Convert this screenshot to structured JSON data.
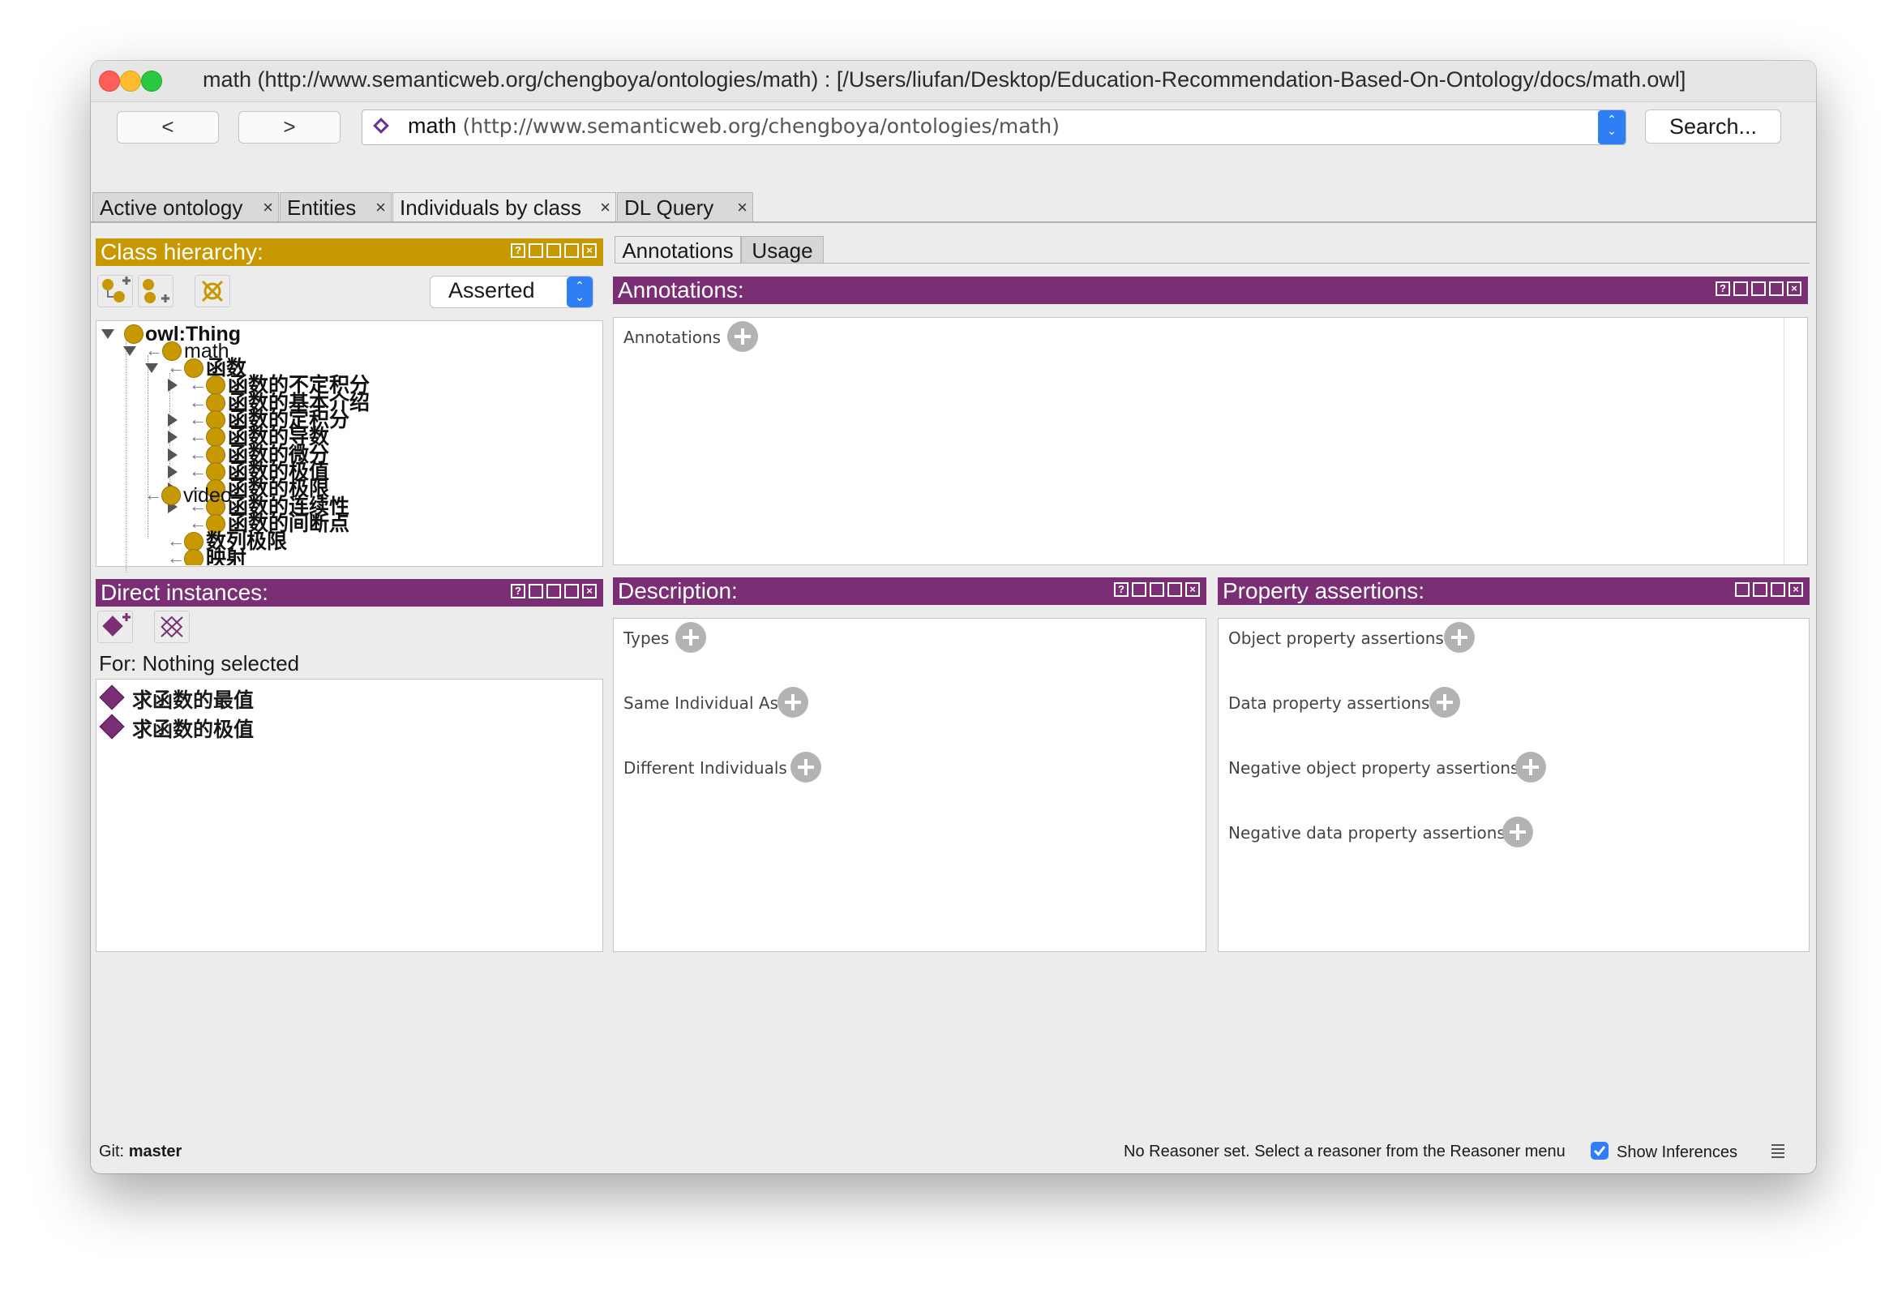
{
  "window": {
    "title": "math (http://www.semanticweb.org/chengboya/ontologies/math)  : [/Users/liufan/Desktop/Education-Recommendation-Based-On-Ontology/docs/math.owl]"
  },
  "toolbar": {
    "back_label": "<",
    "forward_label": ">",
    "ontology_name": "math",
    "ontology_iri": "(http://www.semanticweb.org/chengboya/ontologies/math)",
    "search_label": "Search..."
  },
  "tabs": [
    {
      "label": "Active ontology",
      "active": false
    },
    {
      "label": "Entities",
      "active": false
    },
    {
      "label": "Individuals by class",
      "active": true
    },
    {
      "label": "DL Query",
      "active": false
    }
  ],
  "tab_close": "×",
  "class_hierarchy": {
    "title": "Class hierarchy:",
    "mode": "Asserted",
    "tree": [
      {
        "label": "owl:Thing"
      },
      {
        "label": "math"
      },
      {
        "label": "函数"
      },
      {
        "label": "函数的不定积分"
      },
      {
        "label": "函数的基本介绍"
      },
      {
        "label": "函数的定积分"
      },
      {
        "label": "函数的导数"
      },
      {
        "label": "函数的微分"
      },
      {
        "label": "函数的极值"
      },
      {
        "label": "函数的极限"
      },
      {
        "label": "函数的连续性"
      },
      {
        "label": "函数的间断点"
      },
      {
        "label": "数列极限"
      },
      {
        "label": "映射"
      },
      {
        "label": "video"
      }
    ]
  },
  "direct_instances": {
    "title": "Direct instances:",
    "for_label": "For: Nothing selected",
    "items": [
      "求函数的最值",
      "求函数的极值"
    ]
  },
  "right_tabs": [
    {
      "label": "Annotations",
      "active": true
    },
    {
      "label": "Usage",
      "active": false
    }
  ],
  "annotations": {
    "title": "Annotations:",
    "section": "Annotations"
  },
  "description": {
    "title": "Description:",
    "sections": [
      "Types",
      "Same Individual As",
      "Different Individuals"
    ]
  },
  "property_assertions": {
    "title": "Property assertions:",
    "sections": [
      "Object property assertions",
      "Data property assertions",
      "Negative object property assertions",
      "Negative data property assertions"
    ]
  },
  "status_bar": {
    "git_prefix": "Git:",
    "git_branch": "master",
    "reasoner_message": "No Reasoner set. Select a reasoner from the Reasoner menu",
    "show_inferences_label": "Show Inferences",
    "show_inferences_checked": true
  },
  "colors": {
    "class_header": "#c79800",
    "individual_header": "#7a2f75",
    "checkbox": "#2f7ef5"
  },
  "icons": [
    "close-window-icon",
    "minimize-window-icon",
    "zoom-window-icon",
    "ontology-icon",
    "add-subclass-icon",
    "add-sibling-class-icon",
    "delete-class-icon",
    "add-individual-icon",
    "delete-individual-icon",
    "class-icon",
    "individual-icon",
    "add-icon",
    "log-icon"
  ]
}
